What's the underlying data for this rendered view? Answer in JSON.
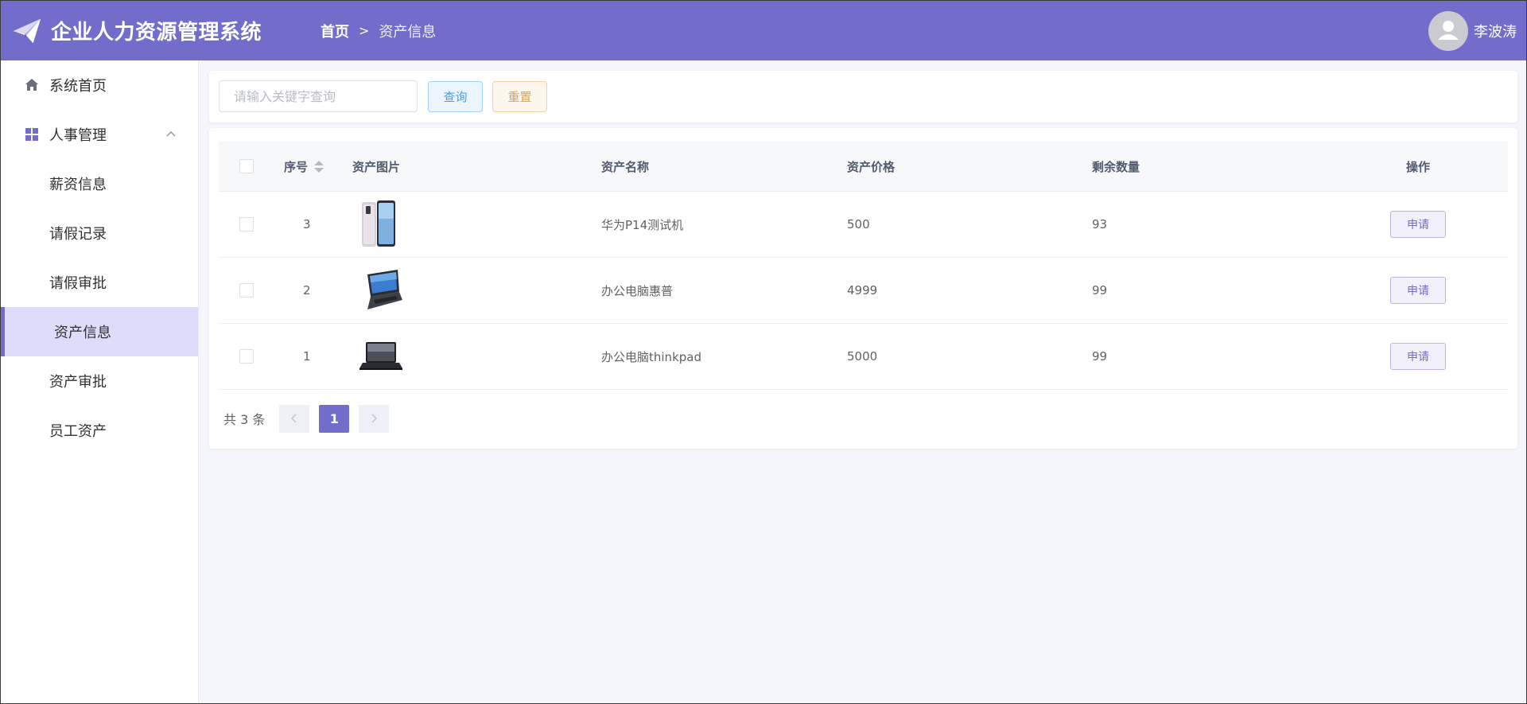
{
  "header": {
    "app_title": "企业人力资源管理系统",
    "breadcrumb": {
      "home": "首页",
      "separator": ">",
      "current": "资产信息"
    },
    "user": {
      "name": "李波涛",
      "avatar_icon": "user-avatar-icon"
    },
    "logo_icon": "paper-plane-icon",
    "colors": {
      "primary": "#726dcb"
    }
  },
  "sidebar": {
    "items": [
      {
        "label": "系统首页",
        "icon": "home-icon",
        "type": "top"
      },
      {
        "label": "人事管理",
        "icon": "grid-icon",
        "type": "top",
        "expanded": true
      },
      {
        "label": "薪资信息",
        "type": "sub"
      },
      {
        "label": "请假记录",
        "type": "sub"
      },
      {
        "label": "请假审批",
        "type": "sub"
      },
      {
        "label": "资产信息",
        "type": "sub",
        "active": true
      },
      {
        "label": "资产审批",
        "type": "sub"
      },
      {
        "label": "员工资产",
        "type": "sub"
      }
    ]
  },
  "search": {
    "placeholder": "请输入关键字查询",
    "value": "",
    "query_label": "查询",
    "reset_label": "重置"
  },
  "table": {
    "columns": {
      "index": "序号",
      "image": "资产图片",
      "name": "资产名称",
      "price": "资产价格",
      "remaining": "剩余数量",
      "action": "操作"
    },
    "rows": [
      {
        "index": "3",
        "image_icon": "phone-icon",
        "name": "华为P14测试机",
        "price": "500",
        "remaining": "93",
        "action": "申请"
      },
      {
        "index": "2",
        "image_icon": "laptop-icon",
        "name": "办公电脑惠普",
        "price": "4999",
        "remaining": "99",
        "action": "申请"
      },
      {
        "index": "1",
        "image_icon": "laptop-icon",
        "name": "办公电脑thinkpad",
        "price": "5000",
        "remaining": "99",
        "action": "申请"
      }
    ]
  },
  "pagination": {
    "total_text": "共 3 条",
    "current_page": "1",
    "prev_icon": "chevron-left-icon",
    "next_icon": "chevron-right-icon"
  }
}
